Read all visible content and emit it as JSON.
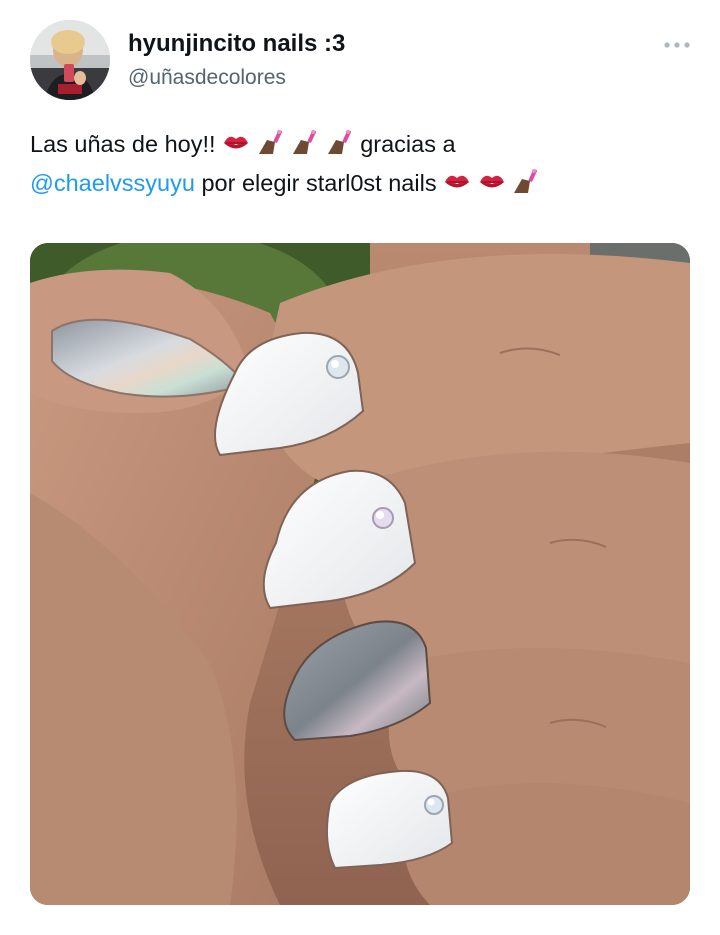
{
  "tweet": {
    "display_name": "hyunjincito nails :3",
    "handle": "@uñasdecolores",
    "more_icon": "more-dots-icon",
    "text": {
      "part1": "Las uñas de hoy!!",
      "part2": "gracias a",
      "mention": "@chaelvssyuyu",
      "part3": "por elegir starl0st nails"
    },
    "emojis_line1": [
      "kiss-mark",
      "nail-polish",
      "nail-polish",
      "nail-polish"
    ],
    "emojis_line2": [
      "kiss-mark",
      "kiss-mark",
      "nail-polish"
    ],
    "colors": {
      "link": "#1d9bf0",
      "handle": "#536471",
      "text": "#0f1419"
    }
  }
}
